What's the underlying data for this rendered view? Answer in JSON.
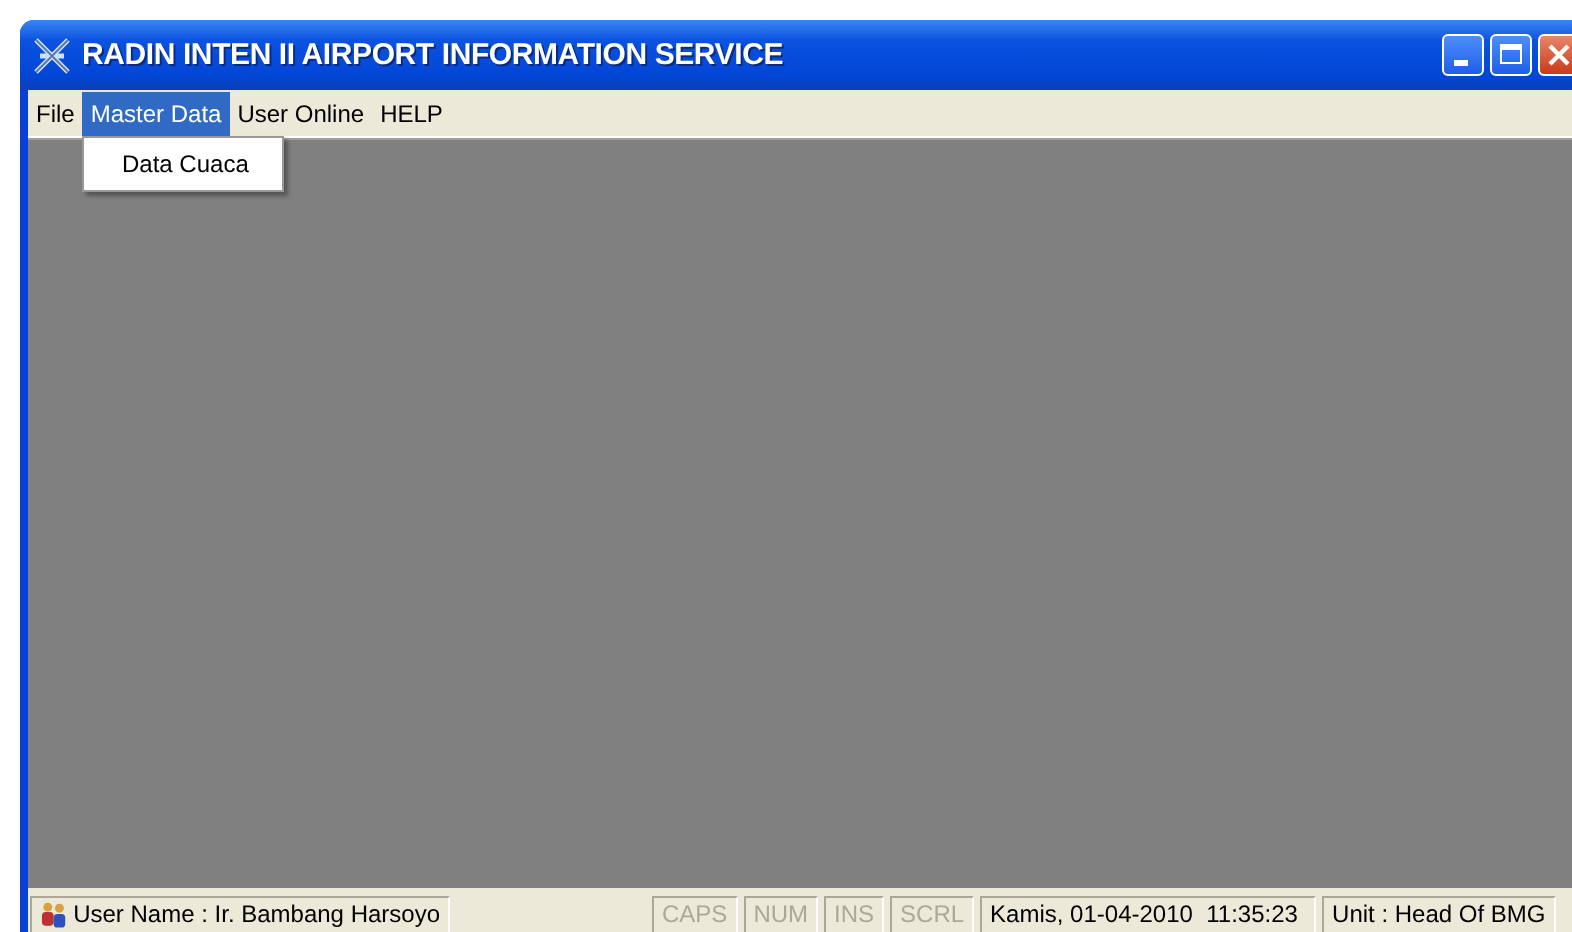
{
  "window": {
    "title": "RADIN INTEN II AIRPORT INFORMATION SERVICE"
  },
  "menu": [
    {
      "label": "File",
      "selected": false
    },
    {
      "label": "Master Data",
      "selected": true,
      "items": [
        "Data Cuaca"
      ]
    },
    {
      "label": "User Online",
      "selected": false
    },
    {
      "label": "HELP",
      "selected": false
    }
  ],
  "status_bar": {
    "user": "User Name : Ir. Bambang Harsoyo",
    "indicators": [
      {
        "label": "CAPS",
        "on": false
      },
      {
        "label": "NUM",
        "on": false
      },
      {
        "label": "INS",
        "on": false
      },
      {
        "label": "SCRL",
        "on": false
      }
    ],
    "datetime": "Kamis, 01-04-2010  11:35:23",
    "unit": "Unit : Head Of BMG"
  }
}
